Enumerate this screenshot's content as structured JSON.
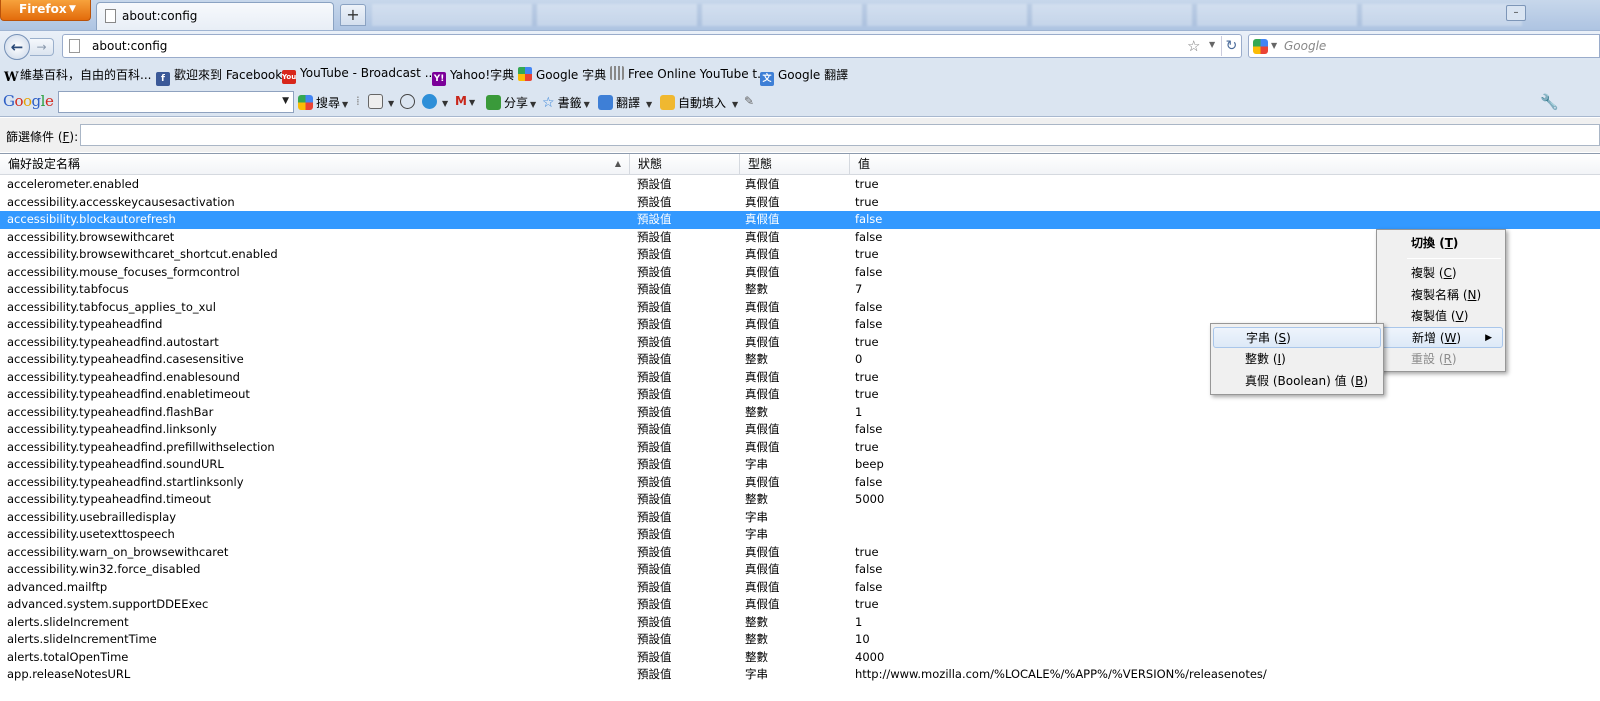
{
  "browser": {
    "app_button_label": "Firefox",
    "active_tab_label": "about:config",
    "new_tab_label": "+"
  },
  "navbar": {
    "url": "about:config",
    "search_placeholder": "Google"
  },
  "bookmarks": [
    {
      "label": "維基百科，自由的百科...",
      "icon": "wikipedia-icon"
    },
    {
      "label": "歡迎來到 Facebook",
      "icon": "facebook-icon"
    },
    {
      "label": "YouTube - Broadcast ...",
      "icon": "youtube-icon"
    },
    {
      "label": "Yahoo!字典",
      "icon": "yahoo-icon"
    },
    {
      "label": "Google 字典",
      "icon": "google-icon"
    },
    {
      "label": "Free Online YouTube t...",
      "icon": "bars-icon"
    },
    {
      "label": "Google 翻譯",
      "icon": "translate-icon"
    }
  ],
  "google_toolbar": {
    "logo": "Google",
    "search_label": "搜尋",
    "share_label": "分享",
    "bookmarks_label": "書籤",
    "translate_label": "翻譯",
    "autofill_label": "自動填入"
  },
  "filter": {
    "label": "篩選條件",
    "accesskey": "F",
    "value": ""
  },
  "columns": {
    "name": "偏好設定名稱",
    "status": "狀態",
    "type": "型態",
    "value": "值"
  },
  "rows": [
    {
      "name": "accelerometer.enabled",
      "status": "預設值",
      "type": "真假值",
      "value": "true"
    },
    {
      "name": "accessibility.accesskeycausesactivation",
      "status": "預設值",
      "type": "真假值",
      "value": "true"
    },
    {
      "name": "accessibility.blockautorefresh",
      "status": "預設值",
      "type": "真假值",
      "value": "false",
      "selected": true
    },
    {
      "name": "accessibility.browsewithcaret",
      "status": "預設值",
      "type": "真假值",
      "value": "false"
    },
    {
      "name": "accessibility.browsewithcaret_shortcut.enabled",
      "status": "預設值",
      "type": "真假值",
      "value": "true"
    },
    {
      "name": "accessibility.mouse_focuses_formcontrol",
      "status": "預設值",
      "type": "真假值",
      "value": "false"
    },
    {
      "name": "accessibility.tabfocus",
      "status": "預設值",
      "type": "整數",
      "value": "7"
    },
    {
      "name": "accessibility.tabfocus_applies_to_xul",
      "status": "預設值",
      "type": "真假值",
      "value": "false"
    },
    {
      "name": "accessibility.typeaheadfind",
      "status": "預設值",
      "type": "真假值",
      "value": "false"
    },
    {
      "name": "accessibility.typeaheadfind.autostart",
      "status": "預設值",
      "type": "真假值",
      "value": "true"
    },
    {
      "name": "accessibility.typeaheadfind.casesensitive",
      "status": "預設值",
      "type": "整數",
      "value": "0"
    },
    {
      "name": "accessibility.typeaheadfind.enablesound",
      "status": "預設值",
      "type": "真假值",
      "value": "true"
    },
    {
      "name": "accessibility.typeaheadfind.enabletimeout",
      "status": "預設值",
      "type": "真假值",
      "value": "true"
    },
    {
      "name": "accessibility.typeaheadfind.flashBar",
      "status": "預設值",
      "type": "整數",
      "value": "1"
    },
    {
      "name": "accessibility.typeaheadfind.linksonly",
      "status": "預設值",
      "type": "真假值",
      "value": "false"
    },
    {
      "name": "accessibility.typeaheadfind.prefillwithselection",
      "status": "預設值",
      "type": "真假值",
      "value": "true"
    },
    {
      "name": "accessibility.typeaheadfind.soundURL",
      "status": "預設值",
      "type": "字串",
      "value": "beep"
    },
    {
      "name": "accessibility.typeaheadfind.startlinksonly",
      "status": "預設值",
      "type": "真假值",
      "value": "false"
    },
    {
      "name": "accessibility.typeaheadfind.timeout",
      "status": "預設值",
      "type": "整數",
      "value": "5000"
    },
    {
      "name": "accessibility.usebrailledisplay",
      "status": "預設值",
      "type": "字串",
      "value": ""
    },
    {
      "name": "accessibility.usetexttospeech",
      "status": "預設值",
      "type": "字串",
      "value": ""
    },
    {
      "name": "accessibility.warn_on_browsewithcaret",
      "status": "預設值",
      "type": "真假值",
      "value": "true"
    },
    {
      "name": "accessibility.win32.force_disabled",
      "status": "預設值",
      "type": "真假值",
      "value": "false"
    },
    {
      "name": "advanced.mailftp",
      "status": "預設值",
      "type": "真假值",
      "value": "false"
    },
    {
      "name": "advanced.system.supportDDEExec",
      "status": "預設值",
      "type": "真假值",
      "value": "true"
    },
    {
      "name": "alerts.slideIncrement",
      "status": "預設值",
      "type": "整數",
      "value": "1"
    },
    {
      "name": "alerts.slideIncrementTime",
      "status": "預設值",
      "type": "整數",
      "value": "10"
    },
    {
      "name": "alerts.totalOpenTime",
      "status": "預設值",
      "type": "整數",
      "value": "4000"
    },
    {
      "name": "app.releaseNotesURL",
      "status": "預設值",
      "type": "字串",
      "value": "http://www.mozilla.com/%LOCALE%/%APP%/%VERSION%/releasenotes/"
    }
  ],
  "context_menu": {
    "toggle": {
      "label": "切換",
      "key": "T"
    },
    "copy": {
      "label": "複製",
      "key": "C"
    },
    "copy_name": {
      "label": "複製名稱",
      "key": "N"
    },
    "copy_value": {
      "label": "複製值",
      "key": "V"
    },
    "new": {
      "label": "新增",
      "key": "W"
    },
    "reset": {
      "label": "重設",
      "key": "R"
    }
  },
  "submenu": {
    "string": {
      "label": "字串",
      "key": "S"
    },
    "integer": {
      "label": "整數",
      "key": "I"
    },
    "boolean": {
      "label": "真假 (Boolean) 值",
      "key": "B"
    }
  }
}
